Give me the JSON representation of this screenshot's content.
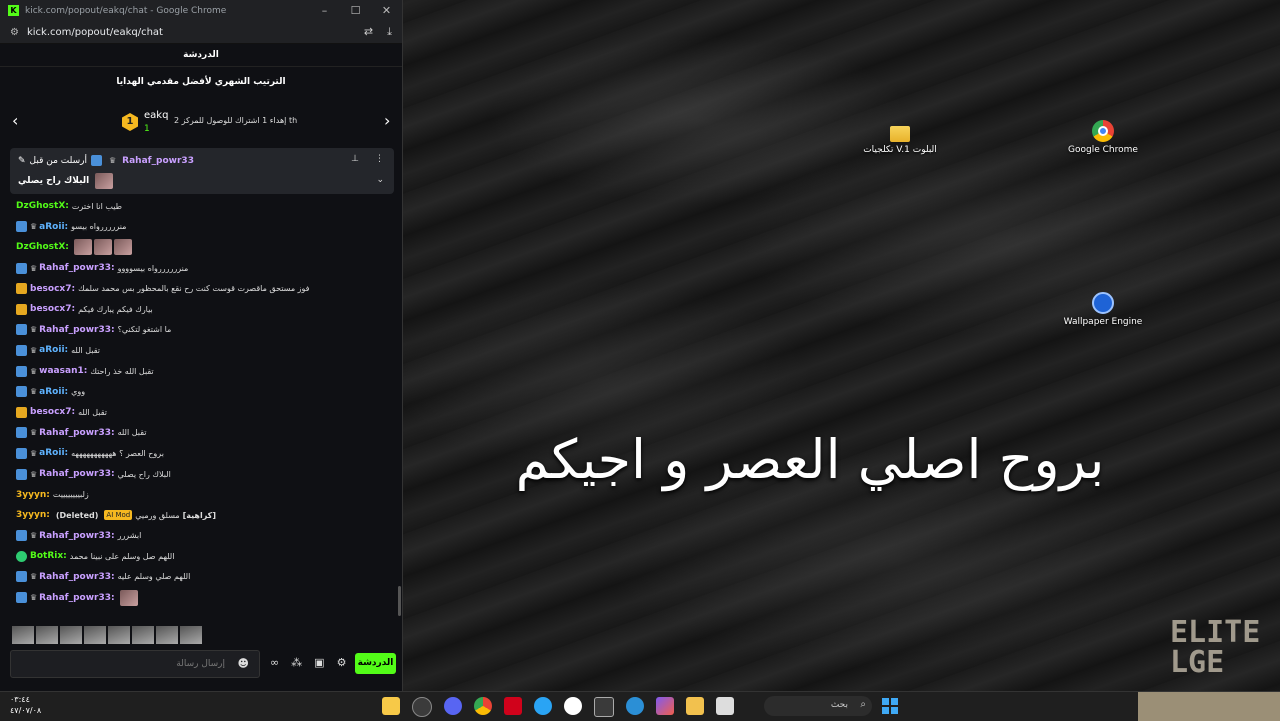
{
  "desktop": {
    "icons": [
      {
        "label": "تكلجيات V.1 البلوت",
        "icon": "folder-icon"
      },
      {
        "label": "Google Chrome",
        "icon": "chrome-icon"
      },
      {
        "label": "Wallpaper Engine",
        "icon": "wallpaper-engine-icon"
      }
    ],
    "overlay_text": "بروح اصلي العصر و اجيكم",
    "logo_text": "ELITE LGE"
  },
  "window": {
    "title": "kick.com/popout/eakq/chat - Google Chrome",
    "controls": [
      "–",
      "☐",
      "✕"
    ],
    "url": "kick.com/popout/eakq/chat"
  },
  "chat": {
    "header": "الدردشة",
    "leaderboard": {
      "title": "الترتيب الشهري لأفضل مقدمي الهدايا",
      "rank": "1",
      "username": "eakq",
      "count": "1",
      "description": "إهداء 1 اشتراك للوصول للمركز 2 th"
    },
    "pinned": {
      "pinned_by_label": "أرسلت من قبل",
      "user": "Rahaf_powr33",
      "text": "البلاك راح يصلي"
    },
    "messages": [
      {
        "user": "DzGhostX",
        "color": "#53fc18",
        "text": "طيب انا اخترت",
        "badge": ""
      },
      {
        "user": "aRoii",
        "color": "#5fb3ff",
        "text": "منرررررواه بيسو",
        "badge": "blue"
      },
      {
        "user": "DzGhostX",
        "color": "#53fc18",
        "text": "",
        "badge": ""
      },
      {
        "user": "Rahaf_powr33",
        "color": "#c9a0ff",
        "text": "منررررررواه بيسوووو",
        "badge": "blue"
      },
      {
        "user": "besocx7",
        "color": "#c9a0ff",
        "text": "فوز مستحق ماقصرت قوست كنت رح نقع بالمحظور بس محمد سلمك",
        "badge": "gold"
      },
      {
        "user": "besocx7",
        "color": "#c9a0ff",
        "text": "بيارك فيكم يبارك فيكم",
        "badge": "gold"
      },
      {
        "user": "Rahaf_powr33",
        "color": "#c9a0ff",
        "text": "ما اشتغو لتكني؟",
        "badge": "blue"
      },
      {
        "user": "aRoii",
        "color": "#5fb3ff",
        "text": "تقبل الله",
        "badge": "blue"
      },
      {
        "user": "waasan1",
        "color": "#c9a0ff",
        "text": "تقبل الله خذ راحتك",
        "badge": "blue"
      },
      {
        "user": "aRoii",
        "color": "#5fb3ff",
        "text": "ووي",
        "badge": "blue"
      },
      {
        "user": "besocx7",
        "color": "#c9a0ff",
        "text": "تقبل الله",
        "badge": "gold"
      },
      {
        "user": "Rahaf_powr33",
        "color": "#c9a0ff",
        "text": "تقبل الله",
        "badge": "blue"
      },
      {
        "user": "aRoii",
        "color": "#5fb3ff",
        "text": "بروح العصر ؟ هههههههههههه",
        "badge": "blue"
      },
      {
        "user": "Rahaf_powr33",
        "color": "#c9a0ff",
        "text": "البلاك راح يصلي",
        "badge": "blue"
      },
      {
        "user": "3yyyn",
        "color": "#f5b820",
        "text": "زلبييييييييت",
        "badge": ""
      },
      {
        "user": "3yyyn",
        "color": "#f5b820",
        "text": "مسلق ورميي",
        "badge": "",
        "deleted": "(Deleted)",
        "mod": "AI Mod",
        "tail": "[كراهية]"
      },
      {
        "user": "Rahaf_powr33",
        "color": "#c9a0ff",
        "text": "ابشررر",
        "badge": "blue"
      },
      {
        "user": "BotRix",
        "color": "#53fc18",
        "text": "اللهم صل وسلم على نبينا محمد",
        "badge": "green"
      },
      {
        "user": "Rahaf_powr33",
        "color": "#c9a0ff",
        "text": "اللهم صلي وسلم عليه",
        "badge": "blue"
      },
      {
        "user": "Rahaf_powr33",
        "color": "#c9a0ff",
        "text": "",
        "badge": "blue"
      }
    ],
    "input_placeholder": "إرسال رسالة",
    "send_label": "الدردشة"
  },
  "taskbar": {
    "time": "٠٣:٤٤",
    "date": "٤٧/٠٧/٠٨",
    "search_label": "بحث"
  }
}
